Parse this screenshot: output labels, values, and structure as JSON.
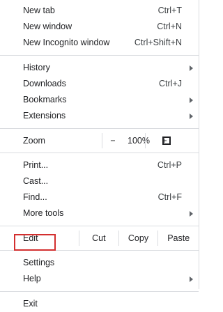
{
  "menu": {
    "group1": [
      {
        "label": "New tab",
        "shortcut": "Ctrl+T"
      },
      {
        "label": "New window",
        "shortcut": "Ctrl+N"
      },
      {
        "label": "New Incognito window",
        "shortcut": "Ctrl+Shift+N"
      }
    ],
    "group2": [
      {
        "label": "History"
      },
      {
        "label": "Downloads",
        "shortcut": "Ctrl+J"
      },
      {
        "label": "Bookmarks"
      },
      {
        "label": "Extensions"
      }
    ],
    "zoom": {
      "label": "Zoom",
      "minus": "−",
      "value": "100%",
      "plus": "+"
    },
    "group3": [
      {
        "label": "Print...",
        "shortcut": "Ctrl+P"
      },
      {
        "label": "Cast..."
      },
      {
        "label": "Find...",
        "shortcut": "Ctrl+F"
      },
      {
        "label": "More tools"
      }
    ],
    "edit": {
      "label": "Edit",
      "cut": "Cut",
      "copy": "Copy",
      "paste": "Paste"
    },
    "group4": [
      {
        "label": "Settings"
      },
      {
        "label": "Help"
      }
    ],
    "exit": {
      "label": "Exit"
    }
  },
  "colors": {
    "highlight": "#d32f2f",
    "separator": "#dadce0"
  }
}
